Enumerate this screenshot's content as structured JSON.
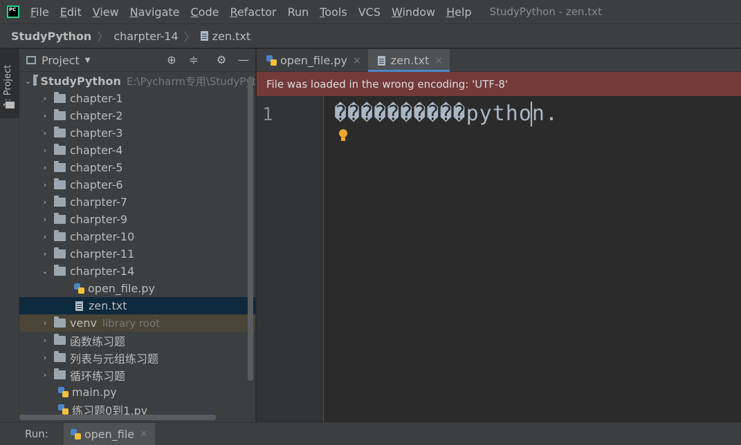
{
  "menubar": {
    "items": [
      {
        "mnemonic": "F",
        "rest": "ile"
      },
      {
        "mnemonic": "E",
        "rest": "dit"
      },
      {
        "mnemonic": "V",
        "rest": "iew"
      },
      {
        "mnemonic": "N",
        "rest": "avigate"
      },
      {
        "mnemonic": "C",
        "rest": "ode"
      },
      {
        "mnemonic": "R",
        "rest": "efactor"
      },
      {
        "mnemonic": "",
        "rest": "Run"
      },
      {
        "mnemonic": "T",
        "rest": "ools"
      },
      {
        "mnemonic": "",
        "rest": "VCS"
      },
      {
        "mnemonic": "W",
        "rest": "indow"
      },
      {
        "mnemonic": "H",
        "rest": "elp"
      }
    ],
    "window_title": "StudyPython - zen.txt"
  },
  "breadcrumb": {
    "project": "StudyPython",
    "folder": "charpter-14",
    "file": "zen.txt"
  },
  "left_strip": {
    "project_label": "1: Project"
  },
  "project_panel": {
    "title": "Project",
    "tree": [
      {
        "label": "StudyPython",
        "hint": "E:\\Pycharm专用\\StudyPyt",
        "type": "folder",
        "expanded": true
      },
      {
        "label": "chapter-1",
        "type": "folder"
      },
      {
        "label": "chapter-2",
        "type": "folder"
      },
      {
        "label": "chapter-3",
        "type": "folder"
      },
      {
        "label": "chapter-4",
        "type": "folder"
      },
      {
        "label": "chapter-5",
        "type": "folder"
      },
      {
        "label": "chapter-6",
        "type": "folder"
      },
      {
        "label": "charpter-7",
        "type": "folder"
      },
      {
        "label": "charpter-9",
        "type": "folder"
      },
      {
        "label": "charpter-10",
        "type": "folder"
      },
      {
        "label": "charpter-11",
        "type": "folder"
      },
      {
        "label": "charpter-14",
        "type": "folder",
        "expanded": true
      },
      {
        "label": "open_file.py",
        "type": "py"
      },
      {
        "label": "zen.txt",
        "type": "txt",
        "selected": true
      },
      {
        "label": "venv",
        "hint": "library root",
        "type": "folder"
      },
      {
        "label": "函数练习题",
        "type": "folder"
      },
      {
        "label": "列表与元组练习题",
        "type": "folder"
      },
      {
        "label": "循环练习题",
        "type": "folder"
      },
      {
        "label": "main.py",
        "type": "py"
      },
      {
        "label": "练习题0到1.py",
        "type": "py"
      }
    ]
  },
  "editor_tabs": [
    {
      "label": "open_file.py",
      "close": "×"
    },
    {
      "label": "zen.txt",
      "close": "×",
      "active": true
    }
  ],
  "encoding_banner": "File was loaded in the wrong encoding: 'UTF-8'",
  "editor": {
    "line_number": "1",
    "code": "����������python."
  },
  "runbar": {
    "label": "Run:",
    "tab": "open_file",
    "close": "×"
  }
}
